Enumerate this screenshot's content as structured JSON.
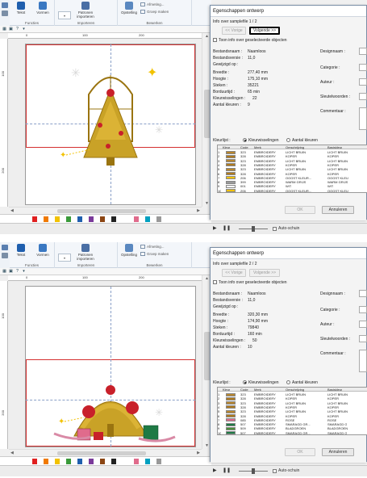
{
  "ribbon": {
    "groups": [
      {
        "label": "Functies"
      },
      {
        "label": "Importeren"
      },
      {
        "label": "Bewerken"
      }
    ],
    "buttons": [
      {
        "label": "Tekst",
        "icon": "text-icon"
      },
      {
        "label": "Vormen",
        "icon": "shapes-icon"
      },
      {
        "label": "Patronen importeren",
        "icon": "patterns-import-icon"
      },
      {
        "label": "Opstelling",
        "icon": "layout-icon"
      }
    ],
    "small": [
      {
        "label": "Afmeting...",
        "icon": "size-icon"
      },
      {
        "label": "Groep maken",
        "icon": "group-icon"
      }
    ],
    "accent": "#1f5fae"
  },
  "rulers": {
    "top": [
      "0",
      "100",
      "200"
    ],
    "left": [
      "100",
      "200"
    ]
  },
  "dialog": {
    "title": "Egenschappen ontwerp",
    "labels": {
      "filename": "Bestandsnaam :",
      "version": "Bestandsversie :",
      "created": "Gewijzigd op :",
      "width": "Breedte :",
      "height": "Hoogte :",
      "stitches": "Steken :",
      "time": "Borduurtijd :",
      "color_changes": "Kleurwisselingen :",
      "num_colors": "Aantal kleuren :",
      "designer": "Designnaam :",
      "category": "Categorie :",
      "author": "Auteur :",
      "keywords": "Sleutelwoorden :",
      "comments": "Commentaar :",
      "color_list": "Kleurlijst :",
      "radio_changes": "Kleurwisselingen",
      "radio_count": "Aantal kleuren",
      "checkbox": "Toon info over geselecteerde objecten"
    },
    "buttons": {
      "prev": "<< Vorige",
      "next": "Volgende >>",
      "ok": "OK",
      "cancel": "Annuleren"
    },
    "table_headers": [
      "Kleur",
      "Code",
      "Merk",
      "Omschrijving",
      "Basiskleur"
    ]
  },
  "panels": [
    {
      "info_line": "Info over samplefile 1 / 2",
      "values": {
        "filename": "Naamloos",
        "version": "11,0",
        "created": "",
        "width": "277,40 mm",
        "height": "175,10 mm",
        "stitches": "35221",
        "time": "65 min",
        "color_changes": "22",
        "num_colors": "9"
      },
      "rows": [
        {
          "n": "1",
          "color": "#b8862e",
          "code": "323",
          "brand": "EMBROIDERY",
          "desc": "LICHT BRUIN",
          "base": "LICHT BRUIN"
        },
        {
          "n": "2",
          "color": "#b07a1e",
          "code": "328",
          "brand": "EMBROIDERY",
          "desc": "KOPER",
          "base": "KOPER"
        },
        {
          "n": "3",
          "color": "#b8862e",
          "code": "323",
          "brand": "EMBROIDERY",
          "desc": "LICHT BRUIN",
          "base": "LICHT BRUIN"
        },
        {
          "n": "4",
          "color": "#b07a1e",
          "code": "328",
          "brand": "EMBROIDERY",
          "desc": "KOPER",
          "base": "KOPER"
        },
        {
          "n": "5",
          "color": "#b8862e",
          "code": "323",
          "brand": "EMBROIDERY",
          "desc": "LICHT BRUIN",
          "base": "LICHT BRUIN"
        },
        {
          "n": "6",
          "color": "#b07a1e",
          "code": "328",
          "brand": "EMBROIDERY",
          "desc": "KOPER",
          "base": "KOPER"
        },
        {
          "n": "7",
          "color": "#f2c200",
          "code": "206",
          "brand": "EMBROIDERY",
          "desc": "OOGST KLEUR...",
          "base": "OOGST KLEU"
        },
        {
          "n": "8",
          "color": "#9a9a9a",
          "code": "399",
          "brand": "EMBROIDERY",
          "desc": "WARM GRIJS",
          "base": "WARM GRIJS"
        },
        {
          "n": "9",
          "color": "#ffffff",
          "code": "001",
          "brand": "EMBROIDERY",
          "desc": "WIT",
          "base": "WIT"
        },
        {
          "n": "10",
          "color": "#f2c200",
          "code": "206",
          "brand": "EMBROIDERY",
          "desc": "OOGST KLEUR...",
          "base": "OOGST KLEU"
        }
      ]
    },
    {
      "info_line": "Info over samplefile 2 / 2",
      "values": {
        "filename": "Naamloos",
        "version": "11,0",
        "created": "",
        "width": "320,30 mm",
        "height": "174,90 mm",
        "stitches": "79840",
        "time": "160 min",
        "color_changes": "50",
        "num_colors": "10"
      },
      "rows": [
        {
          "n": "1",
          "color": "#b8862e",
          "code": "323",
          "brand": "EMBROIDERY",
          "desc": "LICHT BRUIN",
          "base": "LICHT BRUIN"
        },
        {
          "n": "2",
          "color": "#b07a1e",
          "code": "328",
          "brand": "EMBROIDERY",
          "desc": "KOPER",
          "base": "KOPER"
        },
        {
          "n": "3",
          "color": "#b8862e",
          "code": "323",
          "brand": "EMBROIDERY",
          "desc": "LICHT BRUIN",
          "base": "LICHT BRUIN"
        },
        {
          "n": "4",
          "color": "#b07a1e",
          "code": "328",
          "brand": "EMBROIDERY",
          "desc": "KOPER",
          "base": "KOPER"
        },
        {
          "n": "5",
          "color": "#b8862e",
          "code": "323",
          "brand": "EMBROIDERY",
          "desc": "LICHT BRUIN",
          "base": "LICHT BRUIN"
        },
        {
          "n": "6",
          "color": "#b07a1e",
          "code": "328",
          "brand": "EMBROIDERY",
          "desc": "KOPER",
          "base": "KOPER"
        },
        {
          "n": "7",
          "color": "#e06b8c",
          "code": "085",
          "brand": "EMBROIDERY",
          "desc": "ROSE",
          "base": "ROSE"
        },
        {
          "n": "8",
          "color": "#1e7a45",
          "code": "507",
          "brand": "EMBROIDERY",
          "desc": "SMARAGD GR...",
          "base": "SMARAGD G"
        },
        {
          "n": "9",
          "color": "#4c8f3a",
          "code": "509",
          "brand": "EMBROIDERY",
          "desc": "BLADGROEN",
          "base": "BLADGROEN"
        },
        {
          "n": "10",
          "color": "#1e7a45",
          "code": "507",
          "brand": "EMBROIDERY",
          "desc": "SMARAGD GR...",
          "base": "SMARAGD G"
        }
      ]
    }
  ],
  "status": {
    "autoscroll": "Auto-schuin"
  },
  "palette_colors": [
    "#e02020",
    "#f07a00",
    "#f2c200",
    "#3a9a3a",
    "#1f5fae",
    "#7a3a9a",
    "#8b4513",
    "#222222",
    "#ffffff",
    "#e06b8c",
    "#00a0c0",
    "#999999"
  ]
}
